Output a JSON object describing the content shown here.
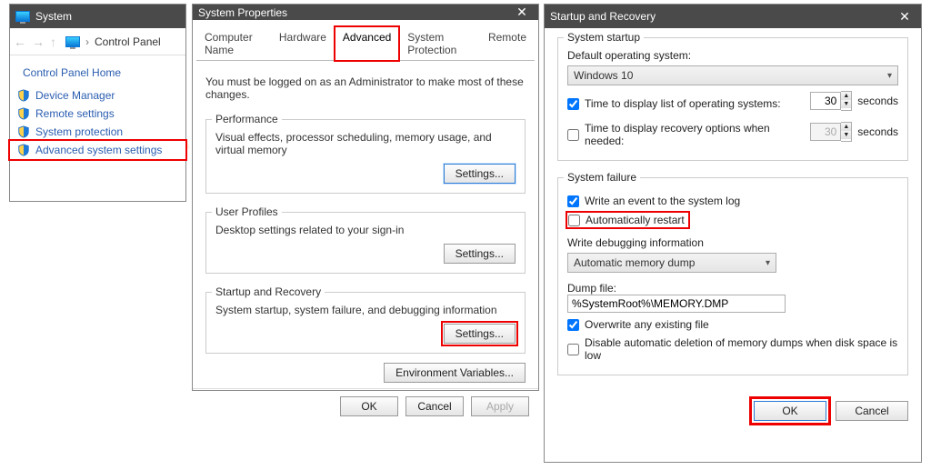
{
  "w1": {
    "title": "System",
    "breadcrumb": "Control Panel",
    "home": "Control Panel Home",
    "links": {
      "device_manager": "Device Manager",
      "remote_settings": "Remote settings",
      "system_protection": "System protection",
      "advanced": "Advanced system settings"
    }
  },
  "w2": {
    "title": "System Properties",
    "tabs": {
      "computer_name": "Computer Name",
      "hardware": "Hardware",
      "advanced": "Advanced",
      "system_protection": "System Protection",
      "remote": "Remote"
    },
    "admin_note": "You must be logged on as an Administrator to make most of these changes.",
    "performance": {
      "legend": "Performance",
      "desc": "Visual effects, processor scheduling, memory usage, and virtual memory",
      "btn": "Settings..."
    },
    "user_profiles": {
      "legend": "User Profiles",
      "desc": "Desktop settings related to your sign-in",
      "btn": "Settings..."
    },
    "startup": {
      "legend": "Startup and Recovery",
      "desc": "System startup, system failure, and debugging information",
      "btn": "Settings..."
    },
    "env_btn": "Environment Variables...",
    "ok": "OK",
    "cancel": "Cancel",
    "apply": "Apply"
  },
  "w3": {
    "title": "Startup and Recovery",
    "startup": {
      "legend": "System startup",
      "default_os_label": "Default operating system:",
      "default_os_value": "Windows 10",
      "time_list": "Time to display list of operating systems:",
      "time_list_val": "30",
      "time_recovery": "Time to display recovery options when needed:",
      "time_recovery_val": "30",
      "seconds": "seconds"
    },
    "failure": {
      "legend": "System failure",
      "write_event": "Write an event to the system log",
      "auto_restart": "Automatically restart",
      "write_debug_label": "Write debugging information",
      "debug_value": "Automatic memory dump",
      "dump_label": "Dump file:",
      "dump_value": "%SystemRoot%\\MEMORY.DMP",
      "overwrite": "Overwrite any existing file",
      "disable_auto_del": "Disable automatic deletion of memory dumps when disk space is low"
    },
    "ok": "OK",
    "cancel": "Cancel"
  }
}
